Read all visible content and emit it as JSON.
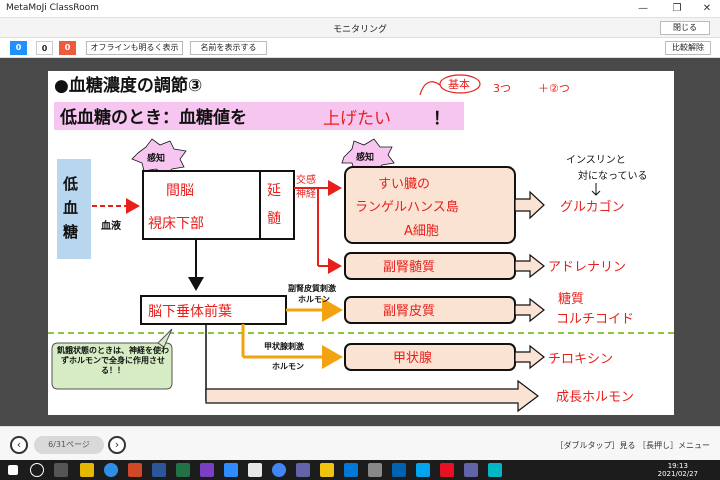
{
  "window": {
    "app_title": "MetaMoJi ClassRoom",
    "minimize": "—",
    "maximize": "❐",
    "close": "✕"
  },
  "subheader": {
    "title": "モニタリング",
    "close_label": "閉じる"
  },
  "toolbar": {
    "count_blue": "0",
    "count_white": "0",
    "count_red": "0",
    "offline_label": "オフラインも明るく表示",
    "names_label": "名前を表示する",
    "compare_off_label": "比較解除"
  },
  "slide": {
    "heading": "●血糖濃度の調節③",
    "banner": "低血糖のとき：血糖値を",
    "banner_answer": "上げたい",
    "banner_excl": "！",
    "note_top": "基本",
    "note_top_2": "3つ",
    "note_top_3": "＋②つ",
    "left_label": [
      "低",
      "血",
      "糖"
    ],
    "blood_label": "血液",
    "sense1": "感知",
    "sense2": "感知",
    "hypothalamus": [
      "間脳",
      "視床下部"
    ],
    "medulla": [
      "延",
      "髄"
    ],
    "sympathetic": [
      "交感",
      "神経"
    ],
    "pancreas": [
      "すい臓の",
      "ランゲルハンス島",
      "A細胞"
    ],
    "adrenal_medulla": "副腎髄質",
    "pituitary": "脳下垂体前葉",
    "acth": [
      "副腎皮質刺激",
      "ホルモン"
    ],
    "adrenal_cortex": "副腎皮質",
    "tsh": [
      "甲状腺刺激",
      "ホルモン"
    ],
    "thyroid": "甲状腺",
    "callout": "飢餓状態のときは、神経を使わずホルモンで全身に作用させる！！",
    "h_glucagon": "グルカゴン",
    "h_adrenaline": "アドレナリン",
    "h_gluco": [
      "糖質",
      "コルチコイド"
    ],
    "h_thyroxine": "チロキシン",
    "h_growth": "成長ホルモン",
    "note_insulin": [
      "インスリンと",
      "対になっている"
    ]
  },
  "bottom": {
    "prev": "‹",
    "page": "6/31ページ",
    "next": "›",
    "hint": "［ダブルタップ］見る ［長押し］メニュー"
  },
  "taskbar": {
    "time": "19:13",
    "date": "2021/02/27"
  },
  "colors": {
    "ink_red": "#e8201c",
    "ink_black": "#111111",
    "box_fill": "#fbe3d3",
    "banner_fill": "#f7c6f0",
    "left_fill": "#b8d7ef",
    "arrow_yellow": "#f2a30f",
    "callout_fill": "#d6ecc4",
    "dash_green": "#8cc63f"
  }
}
